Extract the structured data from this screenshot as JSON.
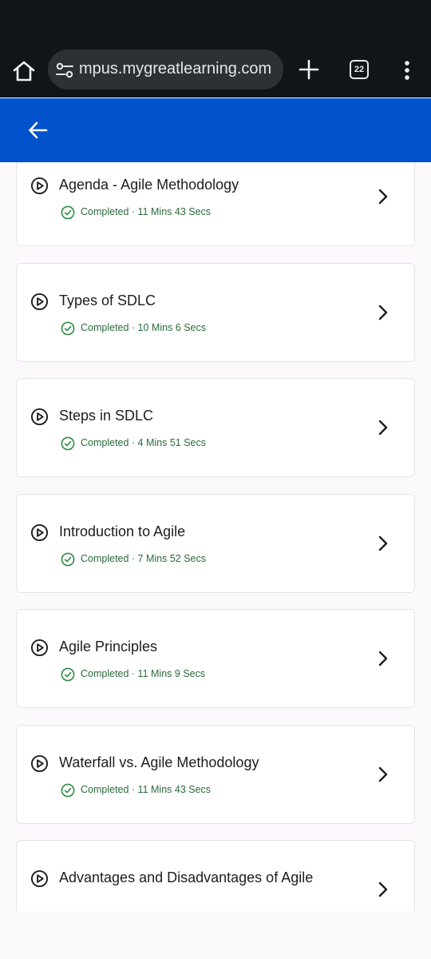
{
  "browser": {
    "url": "mpus.mygreatlearning.com",
    "tab_count": "22"
  },
  "colors": {
    "appbar": "#0252cc",
    "completed_text": "#2a6a3c",
    "check_icon": "#2e8b47"
  },
  "lessons": [
    {
      "title": "Agenda - Agile Methodology",
      "status": "Completed · 11 Mins 43 Secs"
    },
    {
      "title": "Types of SDLC",
      "status": "Completed · 10 Mins 6 Secs"
    },
    {
      "title": "Steps in SDLC",
      "status": "Completed · 4 Mins 51 Secs"
    },
    {
      "title": "Introduction to Agile",
      "status": "Completed · 7 Mins 52 Secs"
    },
    {
      "title": "Agile Principles",
      "status": "Completed · 11 Mins 9 Secs"
    },
    {
      "title": "Waterfall vs. Agile Methodology",
      "status": "Completed · 11 Mins 43 Secs"
    },
    {
      "title": "Advantages and Disadvantages of Agile",
      "status": ""
    }
  ]
}
